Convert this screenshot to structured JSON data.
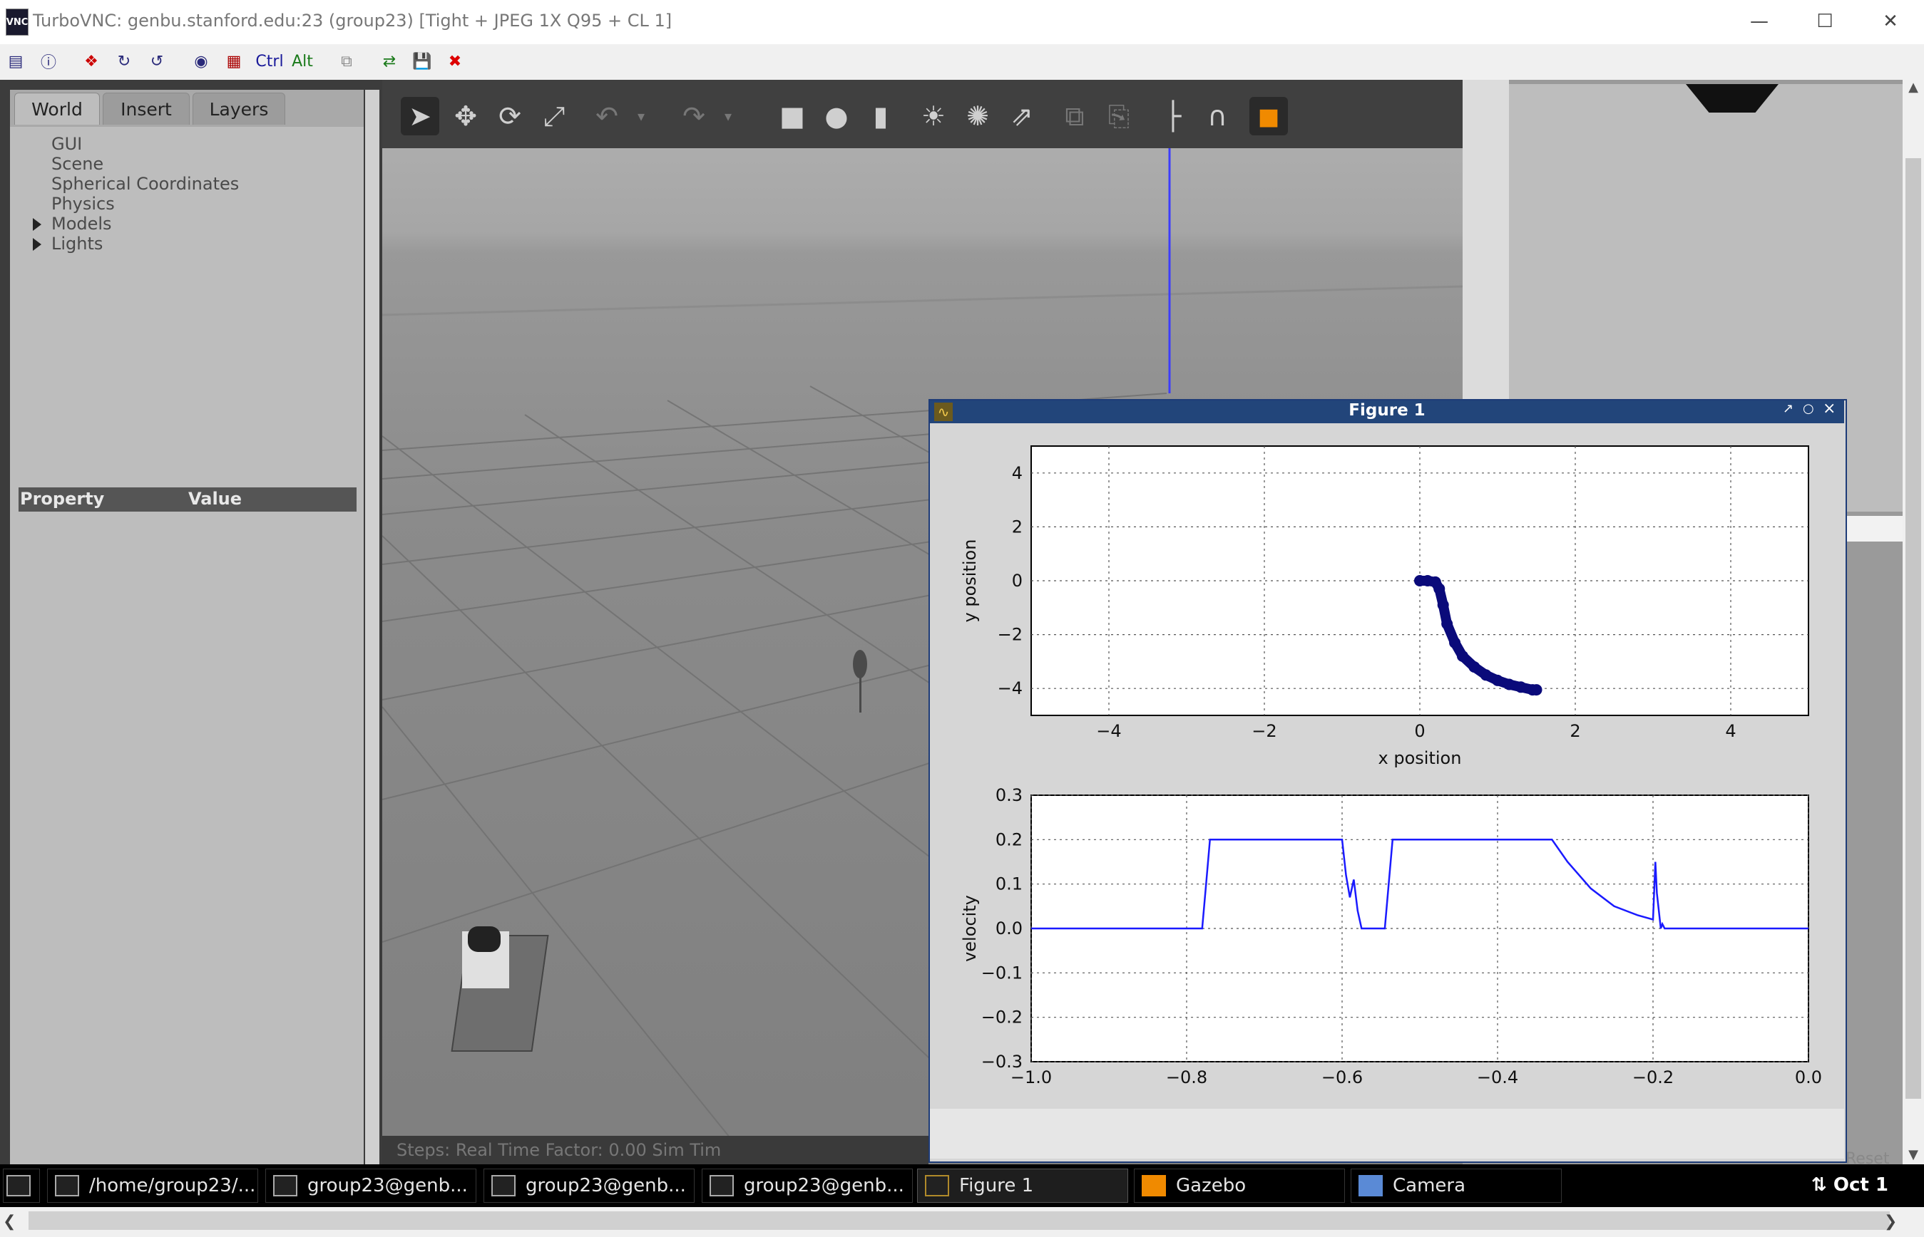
{
  "window": {
    "title": "TurboVNC: genbu.stanford.edu:23 (group23) [Tight + JPEG 1X Q95 + CL 1]",
    "logo": "VNC",
    "controls": [
      "minimize-icon",
      "maximize-icon",
      "close-icon"
    ]
  },
  "vnc_toolbar": {
    "ctrl_label": "Ctrl",
    "alt_label": "Alt"
  },
  "gazebo": {
    "tabs": [
      "World",
      "Insert",
      "Layers"
    ],
    "tree": [
      "GUI",
      "Scene",
      "Spherical Coordinates",
      "Physics",
      "Models",
      "Lights"
    ],
    "property_header": {
      "property": "Property",
      "value": "Value"
    },
    "bottom_bar": "Steps:   Real Time Factor:  0.00   Sim Tim",
    "right_bottom": "Reset"
  },
  "figure": {
    "title": "Figure 1",
    "controls": [
      "resize-icon",
      "maximize-icon",
      "close-icon"
    ]
  },
  "chart_data": [
    {
      "type": "scatter",
      "xlabel": "x position",
      "ylabel": "y position",
      "xlim": [
        -5,
        5
      ],
      "ylim": [
        -5,
        5
      ],
      "xticks": [
        "−4",
        "−2",
        "0",
        "2",
        "4"
      ],
      "yticks": [
        "4",
        "2",
        "0",
        "−2",
        "−4"
      ],
      "grid": true,
      "color": "#0a0a7a",
      "x": [
        0.0,
        0.1,
        0.2,
        0.25,
        0.3,
        0.35,
        0.45,
        0.55,
        0.7,
        0.85,
        1.0,
        1.15,
        1.3,
        1.45,
        1.5
      ],
      "y": [
        0.0,
        0.0,
        -0.05,
        -0.3,
        -0.9,
        -1.6,
        -2.3,
        -2.8,
        -3.2,
        -3.5,
        -3.7,
        -3.85,
        -3.95,
        -4.05,
        -4.05
      ]
    },
    {
      "type": "line",
      "xlabel": "",
      "ylabel": "velocity",
      "xlim": [
        -1.0,
        0.0
      ],
      "ylim": [
        -0.3,
        0.3
      ],
      "xticks": [
        "−1.0",
        "−0.8",
        "−0.6",
        "−0.4",
        "−0.2",
        "0.0"
      ],
      "yticks": [
        "0.3",
        "0.2",
        "0.1",
        "0.0",
        "−0.1",
        "−0.2",
        "−0.3"
      ],
      "grid": true,
      "color": "#1a1aff",
      "x": [
        -1.0,
        -0.78,
        -0.775,
        -0.77,
        -0.6,
        -0.595,
        -0.59,
        -0.585,
        -0.58,
        -0.575,
        -0.56,
        -0.545,
        -0.535,
        -0.33,
        -0.31,
        -0.28,
        -0.25,
        -0.22,
        -0.2,
        -0.197,
        -0.195,
        -0.19,
        -0.188,
        -0.185,
        0.0
      ],
      "y": [
        0.0,
        0.0,
        0.1,
        0.2,
        0.2,
        0.12,
        0.07,
        0.11,
        0.04,
        0.0,
        0.0,
        0.0,
        0.2,
        0.2,
        0.15,
        0.09,
        0.05,
        0.03,
        0.02,
        0.15,
        0.08,
        0.0,
        0.01,
        0.0,
        0.0
      ]
    }
  ],
  "taskbar": {
    "items": [
      "/home/group23/...",
      "group23@genb...",
      "group23@genb...",
      "group23@genb...",
      "Figure 1",
      "Gazebo",
      "Camera"
    ],
    "clock": "Oct 1"
  }
}
